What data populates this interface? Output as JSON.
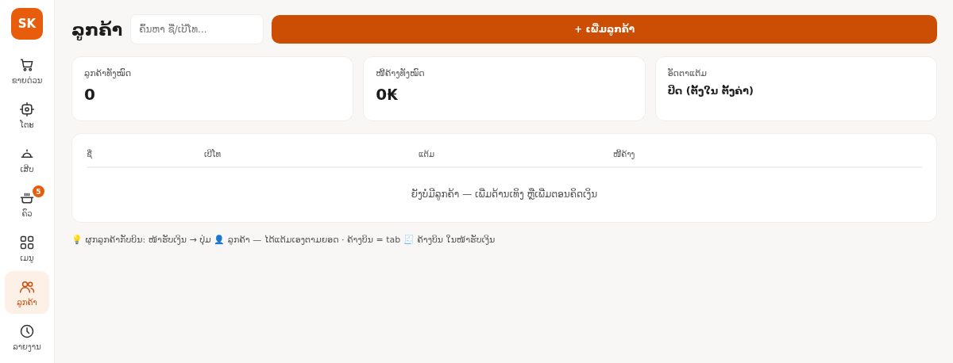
{
  "logo": "SK",
  "nav": [
    {
      "label": "ຂາຍດ່ວນ",
      "kind": "cart",
      "selected": false
    },
    {
      "label": "ໂຕະ",
      "kind": "table",
      "selected": false
    },
    {
      "label": "ເສີບ",
      "kind": "cloche",
      "selected": false
    },
    {
      "label": "ຄົວ",
      "kind": "pot",
      "selected": false,
      "badge": "5"
    },
    {
      "label": "ເມນູ",
      "kind": "grid",
      "selected": false
    },
    {
      "label": "ລູກຄ້າ",
      "kind": "users",
      "selected": true
    },
    {
      "label": "ລາຍງານ",
      "kind": "clock",
      "selected": false
    }
  ],
  "header": {
    "title": "ລູກຄ້າ",
    "search": {
      "placeholder": "ຄົ້ນຫາ ຊື່/ເບີໂທ..."
    },
    "add_button": "+ ເພີ່ມລູກຄ້າ"
  },
  "stats": [
    {
      "label": "ລູກຄ້າທັງໝົດ",
      "value": "0",
      "kind": "big"
    },
    {
      "label": "ໜີ້ຄ້າງທັງໝົດ",
      "value": "0₭",
      "kind": "big"
    },
    {
      "label": "ອັດຕາແຕ້ມ",
      "value": "ປິດ (ຕັ້ງໃນ ຕັ້ງຄ່າ)",
      "kind": "small"
    }
  ],
  "table": {
    "columns": [
      "ຊື່",
      "ເບີໂທ",
      "ແຕ້ມ",
      "ໜີ້ຄ້າງ"
    ],
    "empty": "ຍັງບໍ່ມີລູກຄ້າ — ເພີ່ມດ້ານເທິງ ຫຼືເພີ່ມຕອນຄິດເງິນ"
  },
  "hint": "💡 ຜູກລູກຄ້າກັບບິນ: ໜ້າຮັບເງິນ → ປຸ່ມ 👤 ລູກຄ້າ — ໄດ້ແຕ້ມເອງຕາມຍອດ · ຄ້າງບິນ = tab 🧾 ຄ້າງບິນ ໃນໜ້າຮັບເງິນ"
}
